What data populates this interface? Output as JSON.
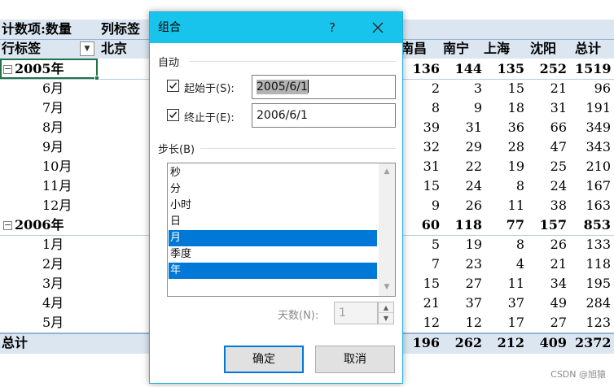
{
  "pivot": {
    "header": {
      "value_field": "计数项:数量",
      "col_label": "列标签",
      "row_label": "行标签",
      "first_city": "北京",
      "cities": [
        "南昌",
        "南宁",
        "上海",
        "沈阳"
      ],
      "total_label": "总计"
    },
    "year_2005": {
      "label": "2005年",
      "totals": [
        "136",
        "144",
        "135",
        "252",
        "1519"
      ],
      "rows": [
        {
          "label": "6月",
          "values": [
            "2",
            "3",
            "15",
            "21",
            "96"
          ]
        },
        {
          "label": "7月",
          "values": [
            "8",
            "9",
            "18",
            "31",
            "191"
          ]
        },
        {
          "label": "8月",
          "values": [
            "39",
            "31",
            "36",
            "66",
            "349"
          ]
        },
        {
          "label": "9月",
          "values": [
            "32",
            "29",
            "28",
            "47",
            "343"
          ]
        },
        {
          "label": "10月",
          "values": [
            "31",
            "22",
            "19",
            "25",
            "210"
          ]
        },
        {
          "label": "11月",
          "values": [
            "15",
            "24",
            "8",
            "24",
            "167"
          ]
        },
        {
          "label": "12月",
          "values": [
            "9",
            "26",
            "11",
            "38",
            "163"
          ]
        }
      ]
    },
    "year_2006": {
      "label": "2006年",
      "totals": [
        "60",
        "118",
        "77",
        "157",
        "853"
      ],
      "rows": [
        {
          "label": "1月",
          "values": [
            "5",
            "19",
            "8",
            "26",
            "133"
          ]
        },
        {
          "label": "2月",
          "values": [
            "7",
            "23",
            "4",
            "21",
            "118"
          ]
        },
        {
          "label": "3月",
          "values": [
            "15",
            "27",
            "11",
            "34",
            "195"
          ]
        },
        {
          "label": "4月",
          "values": [
            "21",
            "37",
            "37",
            "49",
            "284"
          ]
        },
        {
          "label": "5月",
          "values": [
            "12",
            "12",
            "17",
            "27",
            "123"
          ]
        }
      ]
    },
    "grand_total": {
      "label": "总计",
      "values": [
        "196",
        "262",
        "212",
        "409",
        "2372"
      ]
    }
  },
  "dialog": {
    "title": "组合",
    "help_label": "?",
    "auto_section": "自动",
    "start_label": "起始于(S):",
    "start_checked": true,
    "start_value": "2005/6/1",
    "end_label": "终止于(E):",
    "end_checked": true,
    "end_value": "2006/6/1",
    "step_section": "步长(B)",
    "step_items": [
      {
        "label": "秒",
        "selected": false
      },
      {
        "label": "分",
        "selected": false
      },
      {
        "label": "小时",
        "selected": false
      },
      {
        "label": "日",
        "selected": false
      },
      {
        "label": "月",
        "selected": true
      },
      {
        "label": "季度",
        "selected": false
      },
      {
        "label": "年",
        "selected": true
      }
    ],
    "days_label": "天数(N):",
    "days_value": "1",
    "ok_label": "确定",
    "cancel_label": "取消"
  },
  "colors": {
    "title_bar": "#19c4ec",
    "selection": "#0078d7",
    "header_band": "#dce6f1"
  },
  "watermark": "CSDN @旭猿"
}
